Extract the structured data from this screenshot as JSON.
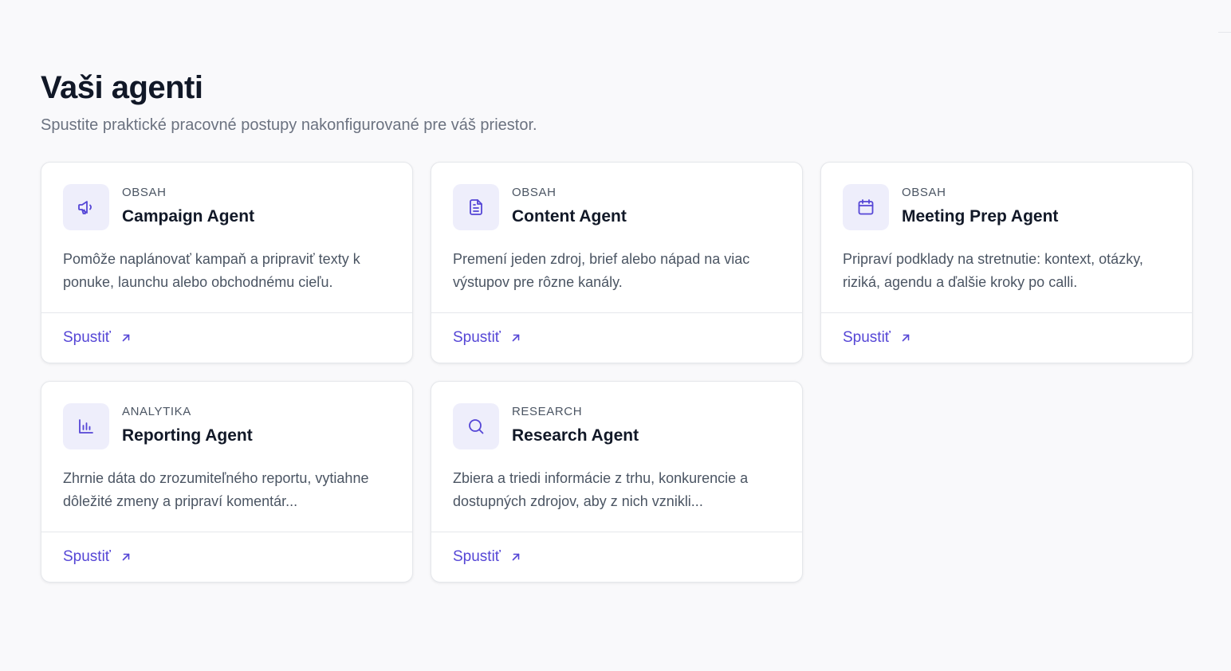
{
  "header": {
    "title": "Vaši agenti",
    "subtitle": "Spustite praktické pracovné postupy nakonfigurované pre váš priestor."
  },
  "colors": {
    "accent": "#5546d6",
    "icon_bg": "#eeeefb"
  },
  "cards": [
    {
      "icon": "megaphone-icon",
      "category": "OBSAH",
      "name": "Campaign Agent",
      "description": "Pomôže naplánovať kampaň a pripraviť texty k ponuke, launchu alebo obchodnému cieľu.",
      "action": "Spustiť"
    },
    {
      "icon": "document-icon",
      "category": "OBSAH",
      "name": "Content Agent",
      "description": "Premení jeden zdroj, brief alebo nápad na viac výstupov pre rôzne kanály.",
      "action": "Spustiť"
    },
    {
      "icon": "calendar-icon",
      "category": "OBSAH",
      "name": "Meeting Prep Agent",
      "description": "Pripraví podklady na stretnutie: kontext, otázky, riziká, agendu a ďalšie kroky po calli.",
      "action": "Spustiť"
    },
    {
      "icon": "bar-chart-icon",
      "category": "ANALYTIKA",
      "name": "Reporting Agent",
      "description": "Zhrnie dáta do zrozumiteľného reportu, vytiahne dôležité zmeny a pripraví komentár...",
      "action": "Spustiť"
    },
    {
      "icon": "search-icon",
      "category": "RESEARCH",
      "name": "Research Agent",
      "description": "Zbiera a triedi informácie z trhu, konkurencie a dostupných zdrojov, aby z nich vznikli...",
      "action": "Spustiť"
    }
  ]
}
